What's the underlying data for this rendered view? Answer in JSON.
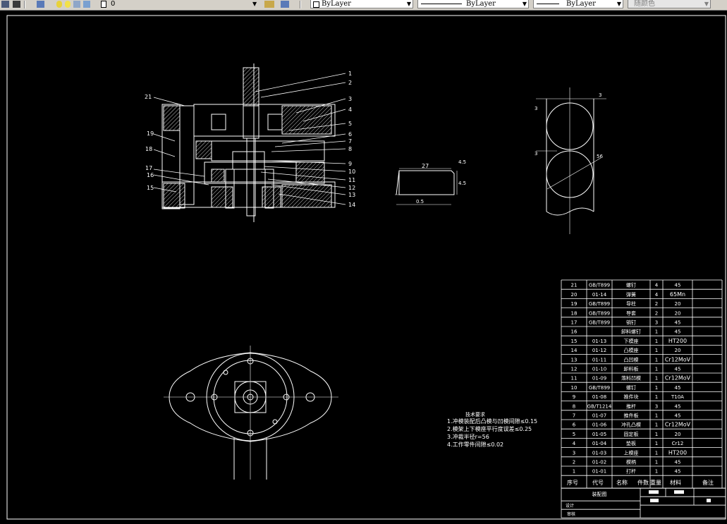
{
  "toolbar": {
    "layer_value": "0",
    "linetype_value": "ByLayer",
    "lineweight_value": "ByLayer",
    "layer_combo_value": "ByLayer",
    "color_value": "随颜色"
  },
  "drawing": {
    "assembly_callouts": [
      "1",
      "2",
      "3",
      "4",
      "5",
      "6",
      "7",
      "8",
      "9",
      "10",
      "11",
      "12",
      "13",
      "14",
      "15",
      "16",
      "17",
      "18",
      "19",
      "21"
    ],
    "part_dims": {
      "width": "27",
      "height": "4.5",
      "tol1": "4.5",
      "bottom": "0.5"
    },
    "circle_dims": {
      "top": "3",
      "side_a": "3",
      "side_b": "3",
      "dia": "56"
    },
    "notes": {
      "title": "技术要求",
      "lines": [
        "1.冲模装配后凸模与凹模间隙≤0.15",
        "2.模架上下模座平行度误差≤0.25",
        "3.冲裁半径r=56",
        "4.工作零件间隙≤0.02"
      ]
    }
  },
  "bom": {
    "rows": [
      {
        "no": "21",
        "code": "GB/T899",
        "name": "螺钉",
        "qty": "4",
        "mat": "45"
      },
      {
        "no": "20",
        "code": "01-14",
        "name": "弹簧",
        "qty": "4",
        "mat": "65Mn"
      },
      {
        "no": "19",
        "code": "GB/T899",
        "name": "导柱",
        "qty": "2",
        "mat": "20"
      },
      {
        "no": "18",
        "code": "GB/T899",
        "name": "导套",
        "qty": "2",
        "mat": "20"
      },
      {
        "no": "17",
        "code": "GB/T899",
        "name": "销钉",
        "qty": "3",
        "mat": "45"
      },
      {
        "no": "16",
        "code": "",
        "name": "卸料螺钉",
        "qty": "1",
        "mat": "45"
      },
      {
        "no": "15",
        "code": "01-13",
        "name": "下模座",
        "qty": "1",
        "mat": "HT200"
      },
      {
        "no": "14",
        "code": "01-12",
        "name": "凸模座",
        "qty": "1",
        "mat": "20"
      },
      {
        "no": "13",
        "code": "01-11",
        "name": "凸凹模",
        "qty": "1",
        "mat": "Cr12MoV"
      },
      {
        "no": "12",
        "code": "01-10",
        "name": "卸料板",
        "qty": "1",
        "mat": "45"
      },
      {
        "no": "11",
        "code": "01-09",
        "name": "落料凹模",
        "qty": "1",
        "mat": "Cr12MoV"
      },
      {
        "no": "10",
        "code": "GB/T899",
        "name": "螺钉",
        "qty": "1",
        "mat": "45"
      },
      {
        "no": "9",
        "code": "01-08",
        "name": "推件块",
        "qty": "1",
        "mat": "T10A"
      },
      {
        "no": "8",
        "code": "GB/T1214",
        "name": "推杆",
        "qty": "3",
        "mat": "45"
      },
      {
        "no": "7",
        "code": "01-07",
        "name": "推件板",
        "qty": "1",
        "mat": "45"
      },
      {
        "no": "6",
        "code": "01-06",
        "name": "冲孔凸模",
        "qty": "1",
        "mat": "Cr12MoV"
      },
      {
        "no": "5",
        "code": "01-05",
        "name": "固定板",
        "qty": "1",
        "mat": "20"
      },
      {
        "no": "4",
        "code": "01-04",
        "name": "垫板",
        "qty": "1",
        "mat": "Cr12"
      },
      {
        "no": "3",
        "code": "01-03",
        "name": "上模座",
        "qty": "1",
        "mat": "HT200"
      },
      {
        "no": "2",
        "code": "01-02",
        "name": "模柄",
        "qty": "1",
        "mat": "45"
      },
      {
        "no": "1",
        "code": "01-01",
        "name": "打杆",
        "qty": "1",
        "mat": "45"
      }
    ],
    "header": {
      "no": "序号",
      "code": "代号",
      "name": "名称",
      "qty": "件数",
      "weight": "重量",
      "mat": "材料",
      "note": "备注"
    },
    "title_block": {
      "name": "装配图",
      "designer": "设计",
      "checker": "审核"
    }
  }
}
